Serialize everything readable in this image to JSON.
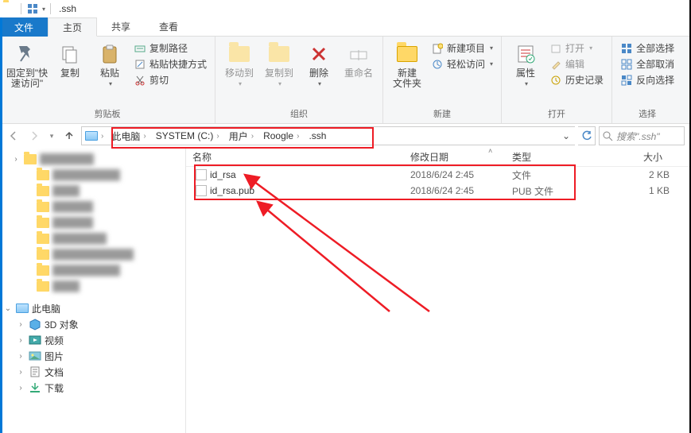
{
  "title": ".ssh",
  "tabs": {
    "file": "文件",
    "home": "主页",
    "share": "共享",
    "view": "查看"
  },
  "ribbon": {
    "clipboard": {
      "pin": "固定到\"快\n速访问\"",
      "copy": "复制",
      "paste": "粘贴",
      "copy_path": "复制路径",
      "paste_shortcut": "粘贴快捷方式",
      "cut": "剪切",
      "label": "剪贴板"
    },
    "organize": {
      "move_to": "移动到",
      "copy_to": "复制到",
      "delete": "删除",
      "rename": "重命名",
      "label": "组织"
    },
    "new": {
      "new_folder": "新建\n文件夹",
      "new_item": "新建项目",
      "easy_access": "轻松访问",
      "label": "新建"
    },
    "open": {
      "properties": "属性",
      "open": "打开",
      "edit": "编辑",
      "history": "历史记录",
      "label": "打开"
    },
    "select": {
      "select_all": "全部选择",
      "select_none": "全部取消",
      "invert": "反向选择",
      "label": "选择"
    }
  },
  "breadcrumbs": [
    "此电脑",
    "SYSTEM (C:)",
    "用户",
    "Roogle",
    ".ssh"
  ],
  "search_placeholder": "搜索\".ssh\"",
  "columns": {
    "name": "名称",
    "date": "修改日期",
    "type": "类型",
    "size": "大小"
  },
  "files": [
    {
      "name": "id_rsa",
      "date": "2018/6/24 2:45",
      "type": "文件",
      "size": "2 KB"
    },
    {
      "name": "id_rsa.pub",
      "date": "2018/6/24 2:45",
      "type": "PUB 文件",
      "size": "1 KB"
    }
  ],
  "tree": {
    "this_pc": "此电脑",
    "objects3d": "3D 对象",
    "videos": "视频",
    "pictures": "图片",
    "documents": "文档",
    "downloads": "下载"
  }
}
